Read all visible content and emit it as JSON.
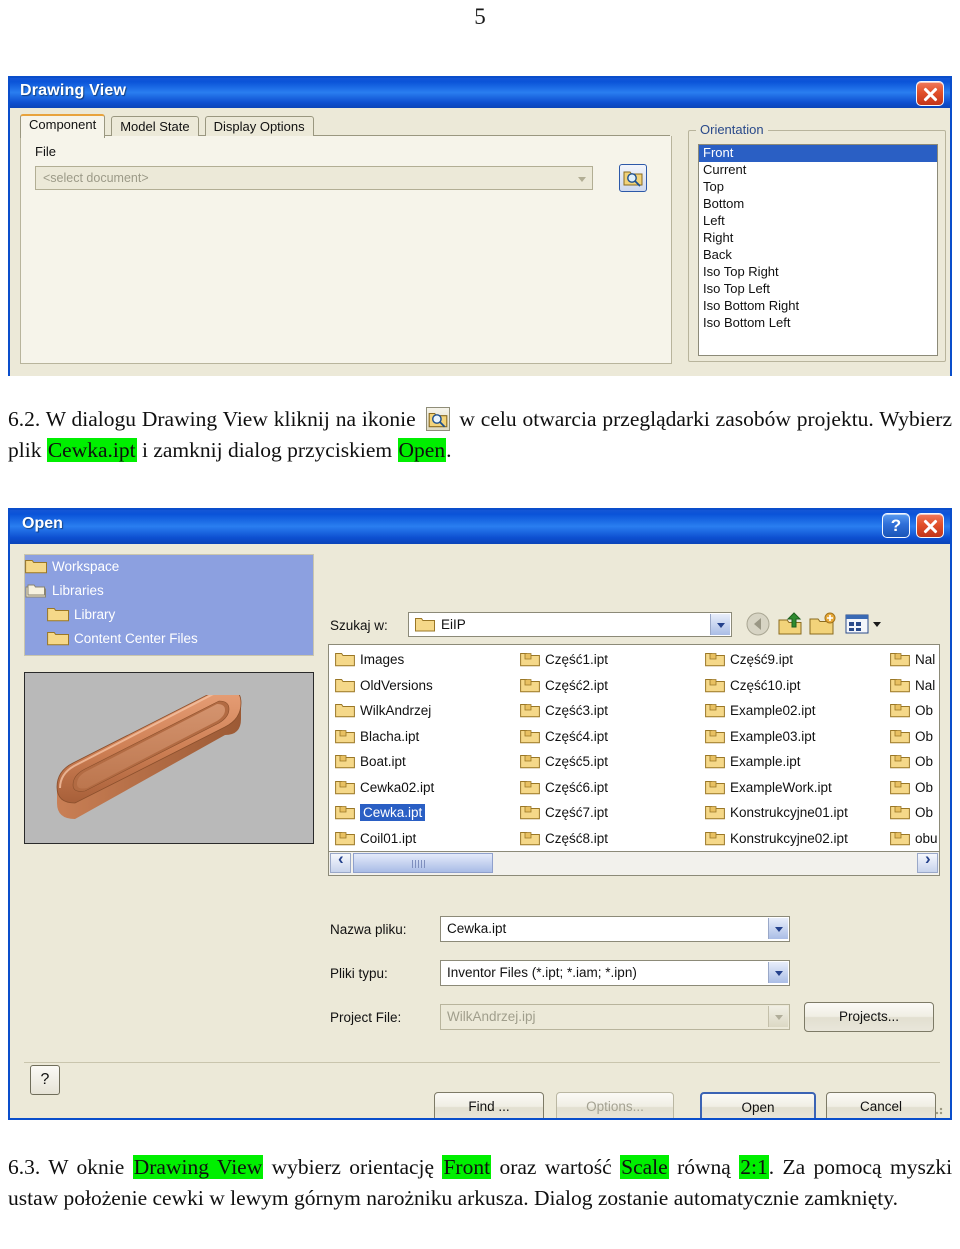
{
  "page": {
    "number": "5"
  },
  "drawing_view": {
    "title": "Drawing View",
    "close_label": "✕",
    "tabs": [
      {
        "label": "Component",
        "active": true
      },
      {
        "label": "Model State",
        "active": false
      },
      {
        "label": "Display Options",
        "active": false
      }
    ],
    "file_group_label": "File",
    "file_value": "<select document>",
    "browse_icon": "magnifier-folder-icon",
    "orientation": {
      "legend": "Orientation",
      "items": [
        "Front",
        "Current",
        "Top",
        "Bottom",
        "Left",
        "Right",
        "Back",
        "Iso Top Right",
        "Iso Top Left",
        "Iso Bottom Right",
        "Iso Bottom Left"
      ],
      "selected": "Front"
    }
  },
  "step_62": {
    "number": "6.2.",
    "text_a": "W dialogu Drawing View kliknij na ikonie",
    "icon": "browse-project-icon",
    "text_b": "w celu otwarcia przeglądarki zasobów projektu. Wybierz plik",
    "highlight_1": "Cewka.ipt",
    "text_c": "i zamknij dialog przyciskiem",
    "highlight_2": "Open",
    "text_d": "."
  },
  "open_dialog": {
    "title": "Open",
    "help_label": "?",
    "close_label": "✕",
    "places": [
      {
        "label": "Workspace",
        "icon": "folder-icon",
        "indent": 0
      },
      {
        "label": "Libraries",
        "icon": "libraries-icon",
        "indent": 0
      },
      {
        "label": "Library",
        "icon": "folder-icon",
        "indent": 1
      },
      {
        "label": "Content Center Files",
        "icon": "folder-icon",
        "indent": 1
      }
    ],
    "preview_alt": "coil-3d-preview",
    "look_in": {
      "label": "Szukaj w:",
      "value": "EiIP",
      "icon": "folder-icon"
    },
    "toolbar_icons": [
      {
        "name": "back-icon"
      },
      {
        "name": "up-one-level-icon"
      },
      {
        "name": "new-folder-icon"
      },
      {
        "name": "views-icon"
      }
    ],
    "file_columns": [
      [
        {
          "name": "Images",
          "type": "folder",
          "selected": false
        },
        {
          "name": "OldVersions",
          "type": "folder",
          "selected": false
        },
        {
          "name": "WilkAndrzej",
          "type": "folder",
          "selected": false
        },
        {
          "name": "Blacha.ipt",
          "type": "part",
          "selected": false
        },
        {
          "name": "Boat.ipt",
          "type": "part",
          "selected": false
        },
        {
          "name": "Cewka02.ipt",
          "type": "part",
          "selected": false
        },
        {
          "name": "Cewka.ipt",
          "type": "part",
          "selected": true
        },
        {
          "name": "Coil01.ipt",
          "type": "part",
          "selected": false
        }
      ],
      [
        {
          "name": "Część1.ipt",
          "type": "part",
          "selected": false
        },
        {
          "name": "Część2.ipt",
          "type": "part",
          "selected": false
        },
        {
          "name": "Część3.ipt",
          "type": "part",
          "selected": false
        },
        {
          "name": "Część4.ipt",
          "type": "part",
          "selected": false
        },
        {
          "name": "Część5.ipt",
          "type": "part",
          "selected": false
        },
        {
          "name": "Część6.ipt",
          "type": "part",
          "selected": false
        },
        {
          "name": "Część7.ipt",
          "type": "part",
          "selected": false
        },
        {
          "name": "Część8.ipt",
          "type": "part",
          "selected": false
        }
      ],
      [
        {
          "name": "Część9.ipt",
          "type": "part",
          "selected": false
        },
        {
          "name": "Część10.ipt",
          "type": "part",
          "selected": false
        },
        {
          "name": "Example02.ipt",
          "type": "part",
          "selected": false
        },
        {
          "name": "Example03.ipt",
          "type": "part",
          "selected": false
        },
        {
          "name": "Example.ipt",
          "type": "part",
          "selected": false
        },
        {
          "name": "ExampleWork.ipt",
          "type": "part",
          "selected": false
        },
        {
          "name": "Konstrukcyjne01.ipt",
          "type": "part",
          "selected": false
        },
        {
          "name": "Konstrukcyjne02.ipt",
          "type": "part",
          "selected": false
        }
      ],
      [
        {
          "name": "Nal",
          "type": "part",
          "selected": false
        },
        {
          "name": "Nal",
          "type": "part",
          "selected": false
        },
        {
          "name": "Ob",
          "type": "part",
          "selected": false
        },
        {
          "name": "Ob",
          "type": "part",
          "selected": false
        },
        {
          "name": "Ob",
          "type": "part",
          "selected": false
        },
        {
          "name": "Ob",
          "type": "part",
          "selected": false
        },
        {
          "name": "Ob",
          "type": "part",
          "selected": false
        },
        {
          "name": "obu",
          "type": "part",
          "selected": false
        }
      ]
    ],
    "fields": {
      "file_name_label": "Nazwa pliku:",
      "file_name_value": "Cewka.ipt",
      "file_type_label": "Pliki typu:",
      "file_type_value": "Inventor Files (*.ipt; *.iam; *.ipn)",
      "project_file_label": "Project File:",
      "project_file_value": "WilkAndrzej.ipj",
      "projects_button": "Projects..."
    },
    "buttons": {
      "help": "?",
      "find": "Find ...",
      "options": "Options...",
      "open": "Open",
      "cancel": "Cancel"
    }
  },
  "step_63": {
    "number": "6.3.",
    "text_a": "W oknie",
    "highlight_1": "Drawing View",
    "text_b": "wybierz orientację",
    "highlight_2": "Front",
    "text_c": "oraz wartość",
    "highlight_3": "Scale",
    "text_d": "równą",
    "highlight_4": "2:1",
    "text_e": ". Za pomocą myszki ustaw położenie cewki w lewym górnym narożniku arkusza. Dialog zostanie automatycznie zamknięty."
  },
  "colors": {
    "titlebar_blue": "#0a53d8",
    "highlight_green": "#00ef00",
    "selection_blue": "#2a5fc4",
    "dialog_face": "#ece9d8",
    "places_blue": "#8ca0e0"
  }
}
